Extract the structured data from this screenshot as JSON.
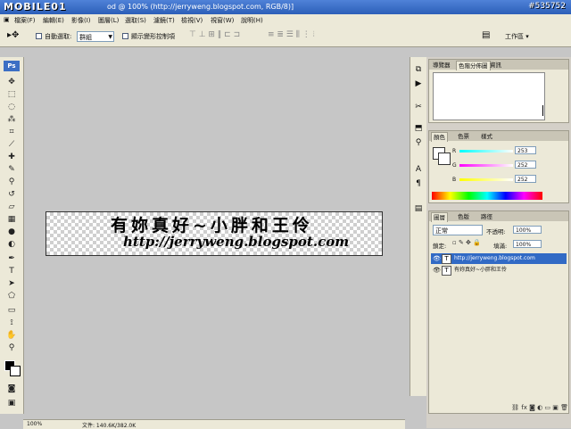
{
  "window": {
    "title_visible": "od @ 100% (http://jerryweng.blogspot.com, RGB/8)]"
  },
  "watermark": {
    "text": "MOBILE01",
    "post_id": "#535752"
  },
  "menu": [
    "檔案(F)",
    "編輯(E)",
    "影像(I)",
    "圖層(L)",
    "選取(S)",
    "濾鏡(T)",
    "檢視(V)",
    "視窗(W)",
    "說明(H)"
  ],
  "options": {
    "auto_select_label": "自動選取:",
    "auto_select_value": "群組",
    "show_transform_label": "顯示變形控制項",
    "workspace_label": "工作區"
  },
  "canvas": {
    "line1": "有妳真好~小胖和王伶",
    "line2": "http://jerryweng.blogspot.com"
  },
  "status": {
    "zoom": "100%",
    "doc_label": "文件: 140.6K/382.0K"
  },
  "panels": {
    "navigator_tabs": [
      "導覽器",
      "色階分佈圖",
      "資訊"
    ],
    "color_tabs": [
      "顏色",
      "色票",
      "樣式"
    ],
    "color": {
      "r_label": "R",
      "g_label": "G",
      "b_label": "B",
      "r": "253",
      "g": "252",
      "b": "252"
    },
    "layers_tabs": [
      "圖層",
      "色版",
      "路徑"
    ],
    "blend_mode": "正常",
    "opacity_label": "不透明:",
    "opacity": "100%",
    "lock_label": "鎖定:",
    "fill_label": "填滿:",
    "fill": "100%",
    "layers": [
      {
        "name": "http://jerryweng.blogspot.com",
        "selected": true
      },
      {
        "name": "有妳真好~小胖和王伶",
        "selected": false
      }
    ]
  },
  "colors": {
    "accent": "#316ac5",
    "titlebar": "#2c5fb8",
    "chrome": "#ece9d8",
    "canvas_bg": "#c6c6c6"
  }
}
